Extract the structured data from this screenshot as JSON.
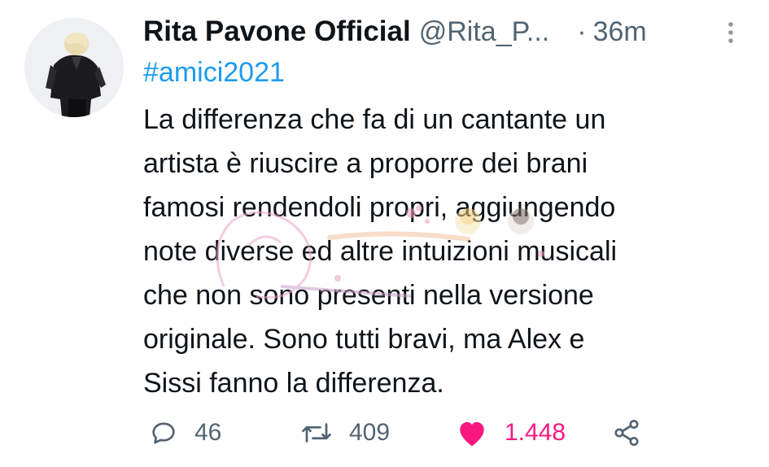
{
  "tweet": {
    "display_name": "Rita Pavone Official",
    "handle": "@Rita_P...",
    "separator": "·",
    "time": "36m",
    "hashtag": "#amici2021",
    "text": "La differenza che fa di un cantante  un\nartista è riuscire  a proporre dei brani\nfamosi rendendoli  propri, aggiungendo\nnote diverse ed altre intuizioni musicali\nche non sono presenti nella versione\noriginale. Sono tutti bravi, ma Alex e\nSissi  fanno la differenza."
  },
  "actions": {
    "reply_count": "46",
    "retweet_count": "409",
    "like_count": "1.448"
  },
  "icons": {
    "reply": "reply-icon",
    "retweet": "retweet-icon",
    "like": "heart-icon",
    "share": "share-icon",
    "more": "more-vertical-icon"
  },
  "colors": {
    "hashtag": "#1d9bf0",
    "muted": "#536471",
    "like": "#f91880",
    "text": "#0f1419"
  }
}
